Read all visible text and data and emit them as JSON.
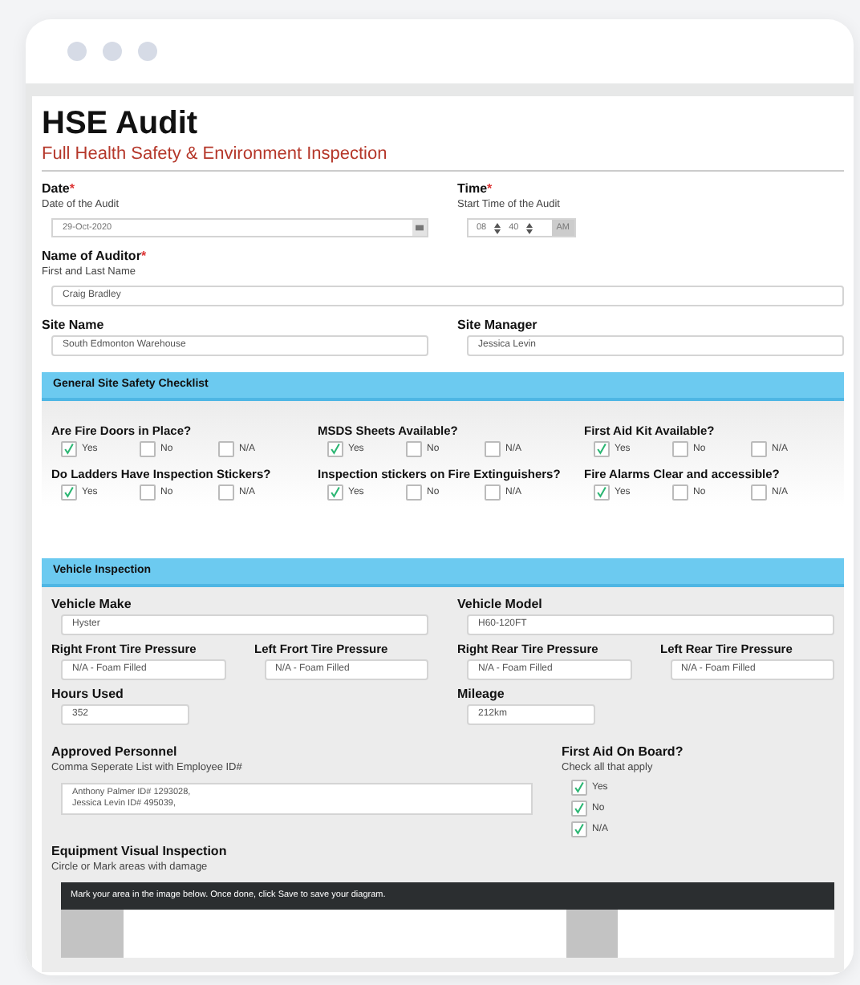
{
  "form": {
    "title": "HSE Audit",
    "subtitle": "Full Health Safety & Environment Inspection"
  },
  "header_fields": [
    {
      "label": "Date",
      "required_mark": "*",
      "hint": "Date of the Audit",
      "kind": "date",
      "value": "29-Oct-2020"
    },
    {
      "label": "Time",
      "required_mark": "*",
      "hint": "Start Time of the Audit",
      "kind": "time",
      "hours": "08",
      "minutes": "40",
      "meridiem": "AM"
    }
  ],
  "auditor": {
    "label": "Name of Auditor",
    "required_mark": "*",
    "hint": "First and Last Name",
    "value": "Craig Bradley"
  },
  "site_fields": [
    {
      "label": "Site Name",
      "value": "South Edmonton Warehouse"
    },
    {
      "label": "Site Manager",
      "value": "Jessica Levin"
    }
  ],
  "checklist": {
    "title": "General Site Safety Checklist",
    "questions": [
      {
        "label": "Are Fire Doors in Place?",
        "options": [
          {
            "label": "Yes",
            "checked": true
          },
          {
            "label": "No",
            "checked": false
          },
          {
            "label": "N/A",
            "checked": false
          }
        ]
      },
      {
        "label": "MSDS Sheets Available?",
        "options": [
          {
            "label": "Yes",
            "checked": true
          },
          {
            "label": "No",
            "checked": false
          },
          {
            "label": "N/A",
            "checked": false
          }
        ]
      },
      {
        "label": "First Aid Kit Available?",
        "options": [
          {
            "label": "Yes",
            "checked": true
          },
          {
            "label": "No",
            "checked": false
          },
          {
            "label": "N/A",
            "checked": false
          }
        ]
      },
      {
        "label": "Do Ladders Have Inspection Stickers?",
        "options": [
          {
            "label": "Yes",
            "checked": true
          },
          {
            "label": "No",
            "checked": false
          },
          {
            "label": "N/A",
            "checked": false
          }
        ]
      },
      {
        "label": "Inspection stickers on Fire Extinguishers?",
        "options": [
          {
            "label": "Yes",
            "checked": true
          },
          {
            "label": "No",
            "checked": false
          },
          {
            "label": "N/A",
            "checked": false
          }
        ]
      },
      {
        "label": "Fire Alarms Clear and accessible?",
        "options": [
          {
            "label": "Yes",
            "checked": true
          },
          {
            "label": "No",
            "checked": false
          },
          {
            "label": "N/A",
            "checked": false
          }
        ]
      }
    ]
  },
  "vehicle": {
    "title": "Vehicle Inspection",
    "wide_fields": [
      {
        "label": "Vehicle Make",
        "value": "Hyster"
      },
      {
        "label": "Vehicle Model",
        "value": "H60-120FT"
      }
    ],
    "tire_fields": [
      {
        "label": "Right Front Tire Pressure",
        "value": "N/A - Foam Filled"
      },
      {
        "label": "Left Frort Tire Pressure",
        "value": "N/A - Foam Filled"
      },
      {
        "label": "Right Rear Tire Pressure",
        "value": "N/A - Foam Filled"
      },
      {
        "label": "Left Rear Tire Pressure",
        "value": "N/A - Foam Filled"
      }
    ],
    "small_fields": [
      {
        "label": "Hours Used",
        "value": "352"
      },
      {
        "label": "Mileage",
        "value": "212km"
      }
    ],
    "personnel": {
      "label": "Approved Personnel",
      "hint": "Comma Seperate List with Employee ID#",
      "value": "Anthony Palmer ID# 1293028,\nJessica Levin ID# 495039,"
    },
    "first_aid": {
      "label": "First Aid On Board?",
      "hint": "Check all that apply",
      "options": [
        {
          "label": "Yes",
          "checked": true
        },
        {
          "label": "No",
          "checked": true
        },
        {
          "label": "N/A",
          "checked": true
        }
      ]
    },
    "visual": {
      "label": "Equipment Visual Inspection",
      "hint": "Circle or Mark areas with damage",
      "instruction": "Mark your area in the image below. Once done, click Save to save your diagram."
    }
  }
}
